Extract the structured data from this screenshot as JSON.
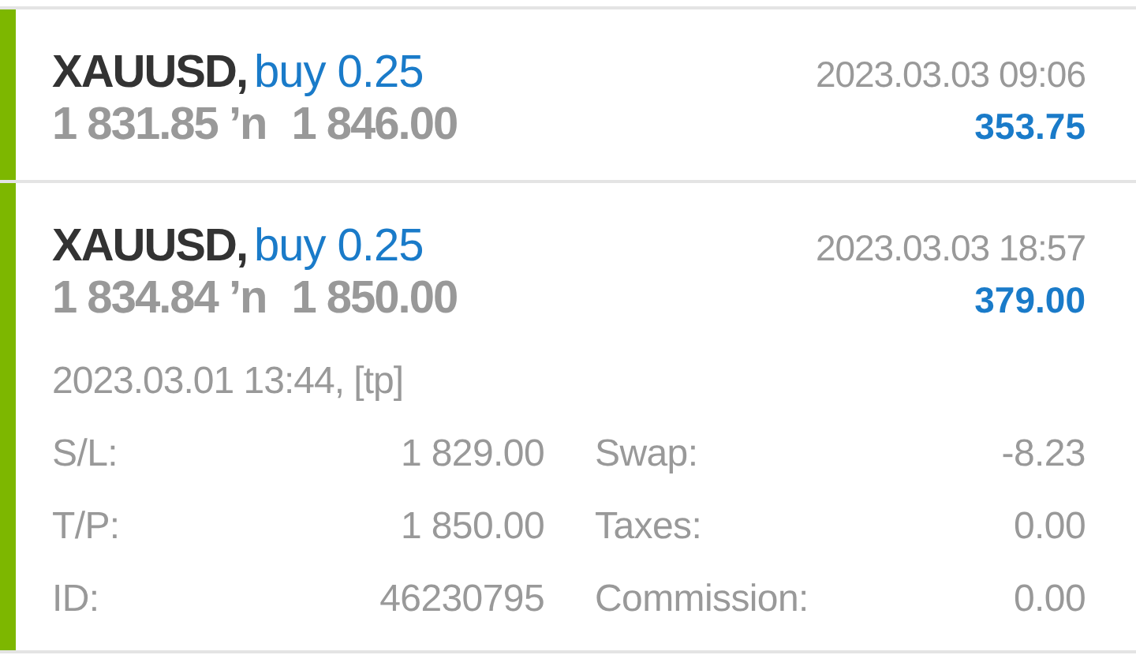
{
  "positions": [
    {
      "symbol": "XAUUSD,",
      "order": "buy 0.25",
      "open_price": "1 831.85",
      "arrow": "ʼn",
      "close_price": "1 846.00",
      "time": "2023.03.03 09:06",
      "profit": "353.75",
      "expanded": false
    },
    {
      "symbol": "XAUUSD,",
      "order": "buy 0.25",
      "open_price": "1 834.84",
      "arrow": "ʼn",
      "close_price": "1 850.00",
      "time": "2023.03.03 18:57",
      "profit": "379.00",
      "expanded": true,
      "open_info": "2023.03.01 13:44, [tp]",
      "details": [
        {
          "label": "S/L:",
          "value": "1 829.00",
          "label_2": "Swap:",
          "value_2": "-8.23"
        },
        {
          "label": "T/P:",
          "value": "1 850.00",
          "label_2": "Taxes:",
          "value_2": "0.00"
        },
        {
          "label": "ID:",
          "value": "46230795",
          "label_2": "Commission:",
          "value_2": "0.00"
        }
      ]
    }
  ]
}
